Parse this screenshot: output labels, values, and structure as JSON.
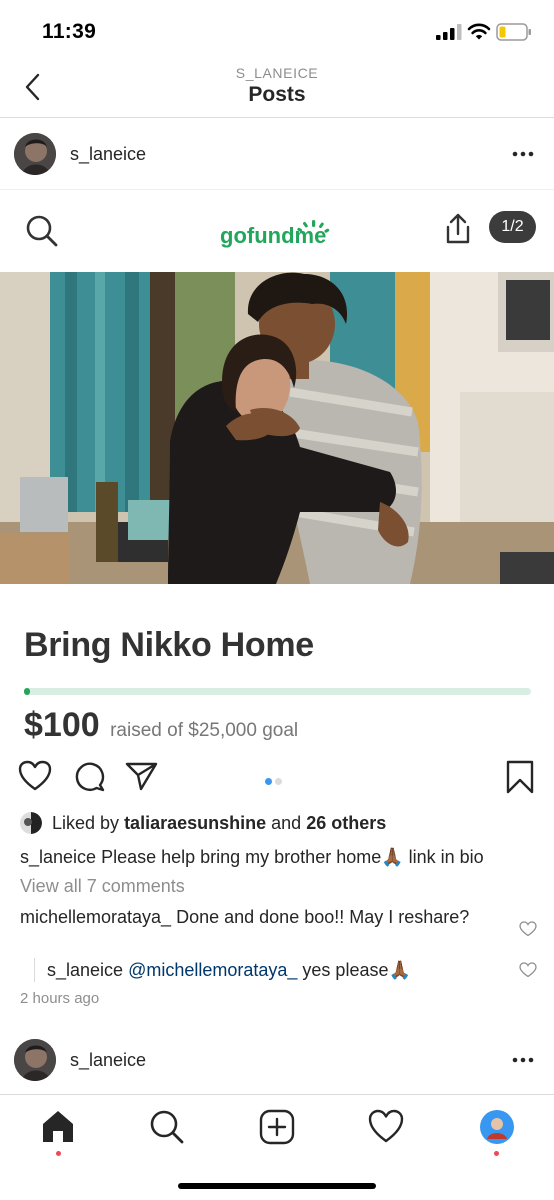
{
  "status_bar": {
    "time": "11:39"
  },
  "header": {
    "username_caps": "S_LANEICE",
    "title": "Posts"
  },
  "post": {
    "username": "s_laneice",
    "gofundme": {
      "logo_text": "gofundme",
      "image_counter": "1/2",
      "campaign_title": "Bring Nikko Home",
      "raised_amount": "$100",
      "raised_of_goal": "raised of $25,000 goal",
      "progress_fraction": 0.004
    },
    "carousel": {
      "count": 2,
      "active": 0
    },
    "likes": {
      "prefix": "Liked by",
      "user": "taliaraesunshine",
      "and": "and",
      "others": "26 others"
    },
    "caption": {
      "user": "s_laneice",
      "text": "Please help bring my brother home🙏🏾  link in bio"
    },
    "view_all_comments": "View all 7 comments",
    "comments": [
      {
        "user": "michellemorataya_",
        "text": "Done and done boo!! May I reshare?"
      }
    ],
    "replies": [
      {
        "user": "s_laneice",
        "mention": "@michellemorataya_",
        "text": " yes please🙏🏾"
      }
    ],
    "time_ago": "2 hours ago"
  },
  "next_post": {
    "username": "s_laneice"
  },
  "colors": {
    "gofundme_green": "#21a65b",
    "progress_track": "#d9eee3",
    "accent_blue": "#3897f0",
    "notification": "#ed4956"
  },
  "tabs": [
    {
      "name": "home",
      "icon": "home-icon"
    },
    {
      "name": "search",
      "icon": "search-icon"
    },
    {
      "name": "new-post",
      "icon": "plus-square-icon"
    },
    {
      "name": "activity",
      "icon": "heart-icon"
    },
    {
      "name": "profile",
      "icon": "avatar"
    }
  ]
}
